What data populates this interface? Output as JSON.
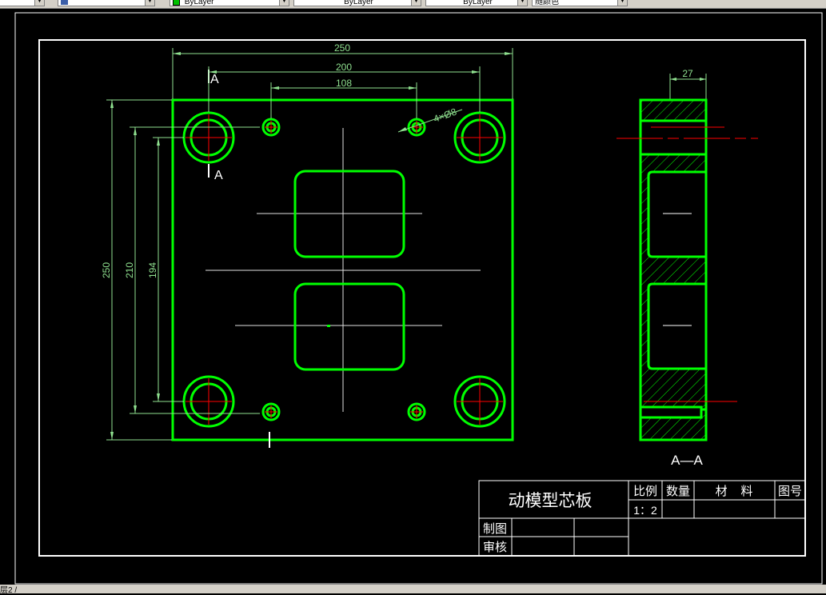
{
  "toolbar": {
    "combos": [
      {
        "label": "",
        "icon": "layer-icon"
      },
      {
        "label": "",
        "icon": "none"
      },
      {
        "label": "ByLayer",
        "icon": "color-swatch-icon"
      },
      {
        "label": "ByLayer",
        "icon": "none"
      },
      {
        "label": "ByLayer",
        "icon": "none"
      },
      {
        "label": "随颜色",
        "icon": "none"
      }
    ]
  },
  "colors": {
    "background": "#000000",
    "outline": "#00ff00",
    "dimension": "#8fe08f",
    "centerline": "#ff0000",
    "text": "#ffffff",
    "frame": "#ffffff"
  },
  "dimensions": {
    "width_total": "250",
    "hole_spacing_outer": "200",
    "hole_spacing_inner": "108",
    "height_total": "250",
    "height_210": "210",
    "height_194": "194",
    "hole_callout": "4×Ø8",
    "thickness": "27"
  },
  "section": {
    "marker": "A",
    "label": "A—A"
  },
  "title_block": {
    "part_name": "动模型芯板",
    "scale_header": "比例",
    "qty_header": "数量",
    "material_header": "材    料",
    "drawing_no_header": "图号",
    "scale_value": "1：2",
    "drawn_by": "制图",
    "checked_by": "审核"
  },
  "status_bar": {
    "text": "层2 /"
  }
}
